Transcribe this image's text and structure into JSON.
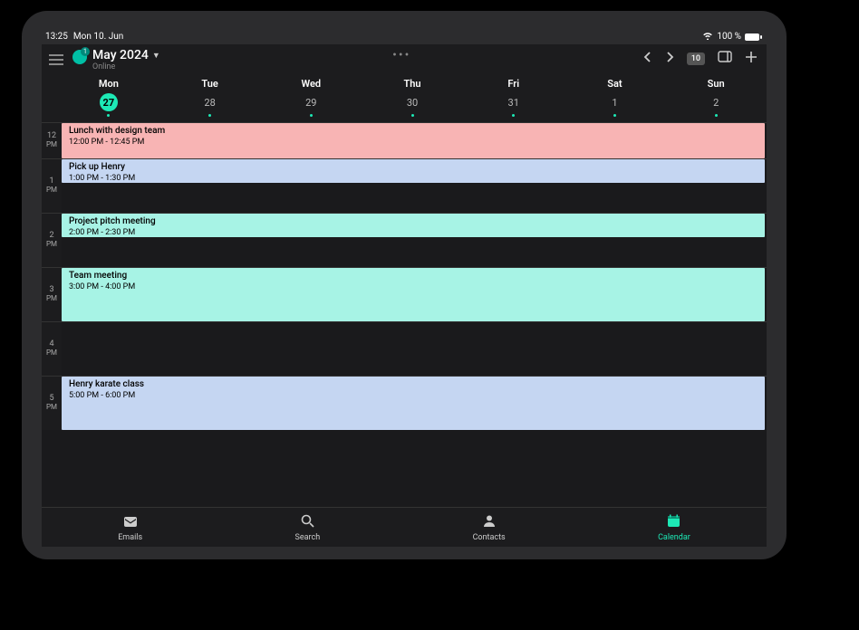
{
  "status": {
    "time": "13:25",
    "date_label": "Mon 10. Jun",
    "battery_pct": "100 %"
  },
  "header": {
    "title": "May 2024",
    "subtitle": "Online",
    "notification_count": "1",
    "date_button": "10"
  },
  "days": [
    {
      "label": "Mon",
      "num": "27",
      "active": true,
      "dot": true
    },
    {
      "label": "Tue",
      "num": "28",
      "active": false,
      "dot": true
    },
    {
      "label": "Wed",
      "num": "29",
      "active": false,
      "dot": true
    },
    {
      "label": "Thu",
      "num": "30",
      "active": false,
      "dot": true
    },
    {
      "label": "Fri",
      "num": "31",
      "active": false,
      "dot": true
    },
    {
      "label": "Sat",
      "num": "1",
      "active": false,
      "dot": true
    },
    {
      "label": "Sun",
      "num": "2",
      "active": false,
      "dot": true
    }
  ],
  "hours": [
    {
      "num": "12",
      "suffix": "PM"
    },
    {
      "num": "1",
      "suffix": "PM"
    },
    {
      "num": "2",
      "suffix": "PM"
    },
    {
      "num": "3",
      "suffix": "PM"
    },
    {
      "num": "4",
      "suffix": "PM"
    },
    {
      "num": "5",
      "suffix": "PM"
    }
  ],
  "events": {
    "h12": {
      "title": "Lunch with design team",
      "time": "12:00 PM - 12:45 PM",
      "color": "#f8b4b4"
    },
    "h1": {
      "title": "Pick up Henry",
      "time": "1:00 PM - 1:30 PM",
      "color": "#c5d6f2"
    },
    "h2": {
      "title": "Project pitch meeting",
      "time": "2:00 PM - 2:30 PM",
      "color": "#a7f3e5"
    },
    "h3": {
      "title": "Team meeting",
      "time": "3:00 PM - 4:00 PM",
      "color": "#a7f3e5"
    },
    "h5": {
      "title": "Henry karate class",
      "time": "5:00 PM - 6:00 PM",
      "color": "#c5d6f2"
    }
  },
  "nav": {
    "emails": "Emails",
    "search": "Search",
    "contacts": "Contacts",
    "calendar": "Calendar"
  }
}
